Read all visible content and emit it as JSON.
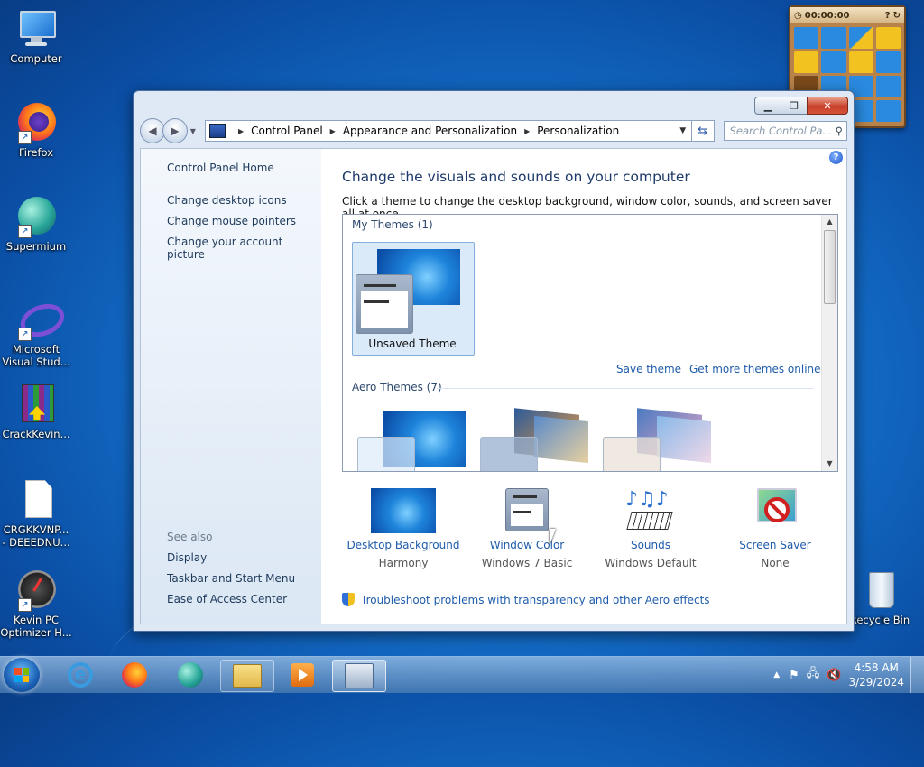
{
  "desktop": {
    "icons": [
      {
        "label": "Computer"
      },
      {
        "label": "Firefox"
      },
      {
        "label": "Supermium"
      },
      {
        "label": "Microsoft Visual Stud..."
      },
      {
        "label": "CrackKevin..."
      },
      {
        "label": "CRGKKVNP... - DEEEDNU..."
      },
      {
        "label": "Kevin PC Optimizer H..."
      },
      {
        "label": "Recycle Bin"
      }
    ]
  },
  "widget": {
    "timer": "00:00:00"
  },
  "window": {
    "breadcrumb": [
      "Control Panel",
      "Appearance and Personalization",
      "Personalization"
    ],
    "search_placeholder": "Search Control Pa...",
    "left_links": [
      "Control Panel Home",
      "Change desktop icons",
      "Change mouse pointers",
      "Change your account picture"
    ],
    "see_also_heading": "See also",
    "see_also_links": [
      "Display",
      "Taskbar and Start Menu",
      "Ease of Access Center"
    ],
    "heading": "Change the visuals and sounds on your computer",
    "subheading": "Click a theme to change the desktop background, window color, sounds, and screen saver all at once.",
    "my_themes_heading": "My Themes (1)",
    "selected_theme": "Unsaved Theme",
    "save_theme": "Save theme",
    "get_more_themes": "Get more themes online",
    "aero_themes_heading": "Aero Themes (7)",
    "bottom": [
      {
        "label": "Desktop Background",
        "value": "Harmony"
      },
      {
        "label": "Window Color",
        "value": "Windows 7 Basic"
      },
      {
        "label": "Sounds",
        "value": "Windows Default"
      },
      {
        "label": "Screen Saver",
        "value": "None"
      }
    ],
    "troubleshoot": "Troubleshoot problems with transparency and other Aero effects"
  },
  "taskbar": {
    "time": "4:58 AM",
    "date": "3/29/2024"
  }
}
